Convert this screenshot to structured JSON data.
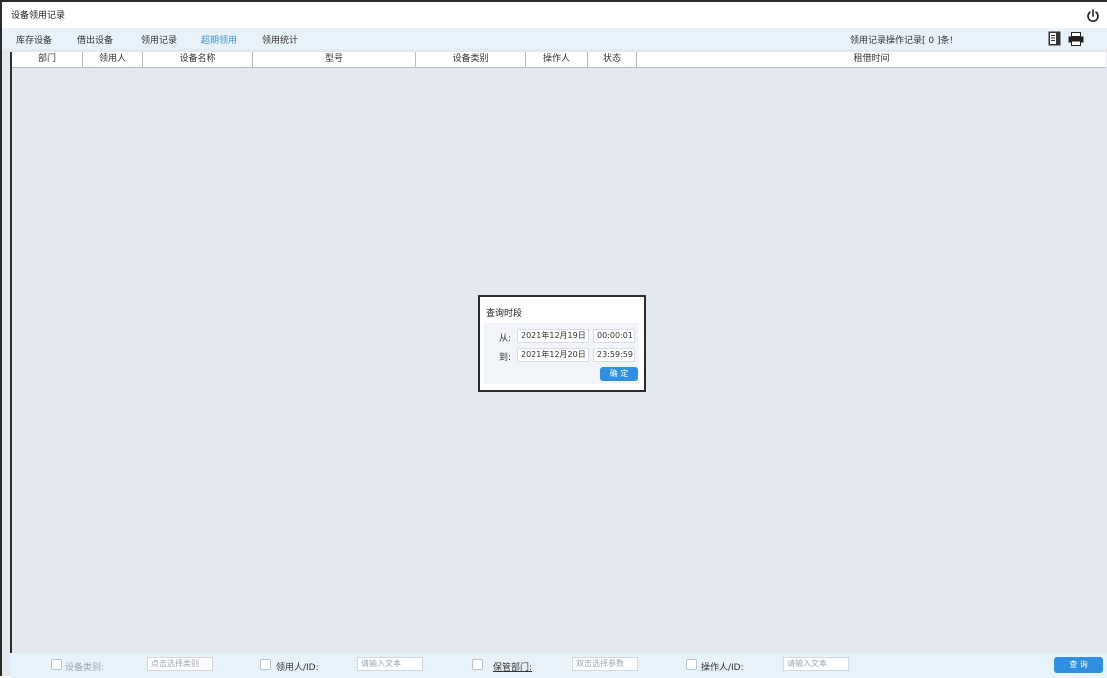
{
  "window": {
    "title": "设备领用记录"
  },
  "tabs": [
    {
      "label": "库存设备"
    },
    {
      "label": "借出设备"
    },
    {
      "label": "领用记录"
    },
    {
      "label": "超期领用",
      "active": true
    },
    {
      "label": "领用统计"
    }
  ],
  "record_info": "领用记录操作记录[ 0 ]条!",
  "columns": [
    "部门",
    "领用人",
    "设备名称",
    "型号",
    "设备类别",
    "操作人",
    "状态",
    "租借时间"
  ],
  "dialog": {
    "title": "查询时段",
    "from_label": "从:",
    "from_date": "2021年12月19日",
    "from_time": "00:00:01",
    "to_label": "到:",
    "to_date": "2021年12月20日",
    "to_time": "23:59:59",
    "ok_label": "确 定"
  },
  "filters": {
    "category_label": "设备类别:",
    "category_placeholder": "点击选择类别",
    "user_label": "领用人/ID:",
    "user_placeholder": "请输入文本",
    "dept_label": "保管部门:",
    "dept_placeholder": "双击选择参数",
    "operator_label": "操作人/ID:",
    "operator_placeholder": "请输入文本",
    "query_label": "查 询"
  },
  "colors": {
    "accent": "#2f8fe0",
    "active_tab": "#3a96d8",
    "grid_bg": "#e4e9f0",
    "bar_bg": "#e8f2fa"
  },
  "icons": [
    "power-icon",
    "export-document-icon",
    "print-icon"
  ]
}
